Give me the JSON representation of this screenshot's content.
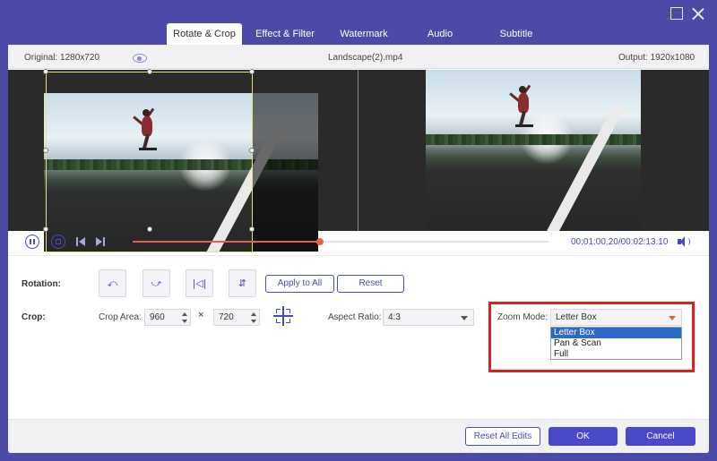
{
  "window": {
    "maximize_icon": "maximize-icon",
    "close_icon": "close-icon"
  },
  "tabs": [
    {
      "label": "Rotate & Crop",
      "active": true
    },
    {
      "label": "Effect & Filter",
      "active": false
    },
    {
      "label": "Watermark",
      "active": false
    },
    {
      "label": "Audio",
      "active": false
    },
    {
      "label": "Subtitle",
      "active": false
    }
  ],
  "info": {
    "original": "Original: 1280x720",
    "filename": "Landscape(2).mp4",
    "output": "Output: 1920x1080",
    "eye_icon": "eye-icon"
  },
  "playback": {
    "timecode": "00:01:00.20/00:02:13.10",
    "progress": 0.45,
    "colors": {
      "accent": "#4a49b8",
      "progress": "#e4633d"
    }
  },
  "rotation": {
    "label": "Rotation:",
    "buttons": [
      {
        "name": "rotate-left",
        "glyph": "⤺"
      },
      {
        "name": "rotate-right",
        "glyph": "⤻"
      },
      {
        "name": "flip-horizontal",
        "glyph": "|◁|"
      },
      {
        "name": "flip-vertical",
        "glyph": "⇵"
      }
    ],
    "apply_all": "Apply to All",
    "reset": "Reset"
  },
  "crop": {
    "label": "Crop:",
    "area_label": "Crop Area:",
    "width": "960",
    "times": "×",
    "height": "720",
    "aspect_label": "Aspect Ratio:",
    "aspect_value": "4:3"
  },
  "zoom": {
    "label": "Zoom Mode:",
    "value": "Letter Box",
    "options": [
      "Letter Box",
      "Pan & Scan",
      "Full"
    ],
    "selected_index": 0
  },
  "footer": {
    "reset_all": "Reset All Edits",
    "ok": "OK",
    "cancel": "Cancel"
  }
}
